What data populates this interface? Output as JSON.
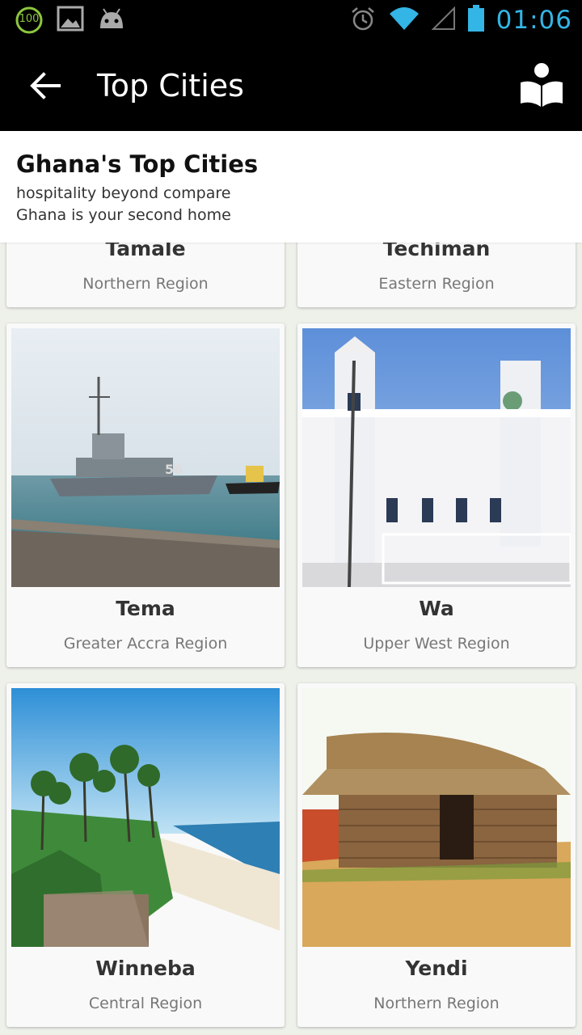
{
  "status_bar": {
    "battery_badge": "100",
    "clock": "01:06"
  },
  "action_bar": {
    "title": "Top Cities"
  },
  "header": {
    "title": "Ghana's Top Cities",
    "subtitle_line1": "hospitality beyond compare",
    "subtitle_line2": "Ghana is your second home"
  },
  "cities": [
    {
      "name": "Tamale",
      "region": "Northern Region"
    },
    {
      "name": "Techiman",
      "region": "Eastern Region"
    },
    {
      "name": "Tema",
      "region": "Greater Accra Region"
    },
    {
      "name": "Wa",
      "region": "Upper West Region"
    },
    {
      "name": "Winneba",
      "region": "Central Region"
    },
    {
      "name": "Yendi",
      "region": "Northern Region"
    }
  ],
  "colors": {
    "clock_accent": "#33b5e5",
    "battery_green": "#8dc63f"
  }
}
